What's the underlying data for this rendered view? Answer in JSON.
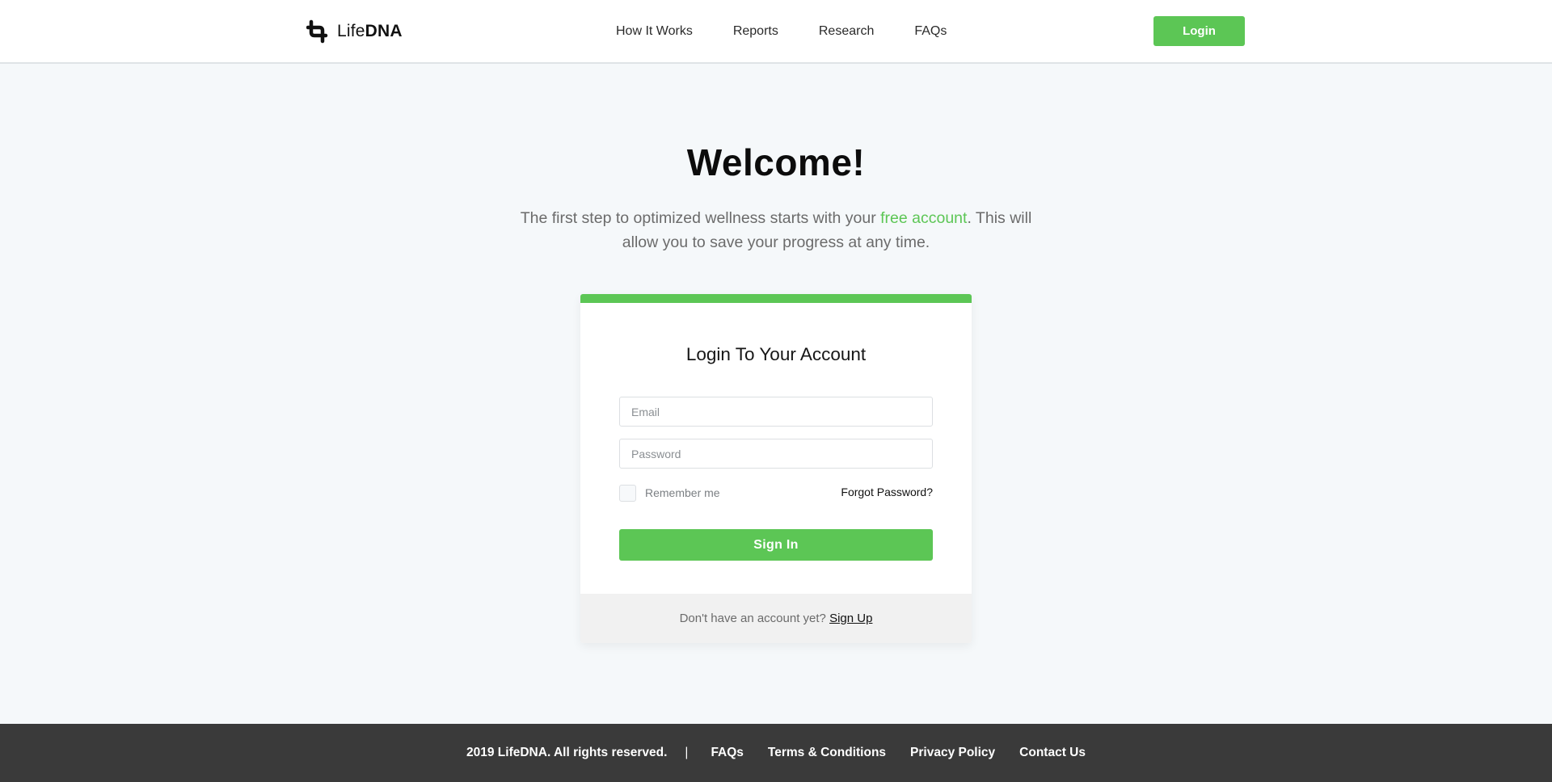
{
  "header": {
    "logo": {
      "light": "Life",
      "bold": "DNA"
    },
    "nav": [
      {
        "label": "How It Works"
      },
      {
        "label": "Reports"
      },
      {
        "label": "Research"
      },
      {
        "label": "FAQs"
      }
    ],
    "login_label": "Login"
  },
  "hero": {
    "title": "Welcome!",
    "intro_before": "The first step to optimized wellness starts with your ",
    "intro_accent": "free account",
    "intro_after": ". This will allow you to save your progress at any time."
  },
  "login_card": {
    "title": "Login To Your Account",
    "email_placeholder": "Email",
    "password_placeholder": "Password",
    "remember_label": "Remember me",
    "forgot_label": "Forgot Password?",
    "signin_label": "Sign In",
    "footer_text": "Don't have an account yet? ",
    "signup_label": "Sign Up"
  },
  "footer": {
    "copyright": "2019 LifeDNA. All rights reserved.",
    "separator": "|",
    "links": [
      {
        "label": "FAQs"
      },
      {
        "label": "Terms & Conditions"
      },
      {
        "label": "Privacy Policy"
      },
      {
        "label": "Contact Us"
      }
    ]
  },
  "colors": {
    "brand_green": "#5cc655",
    "footer_bg": "#3a3a3a",
    "page_bg": "#f5f8fa"
  }
}
